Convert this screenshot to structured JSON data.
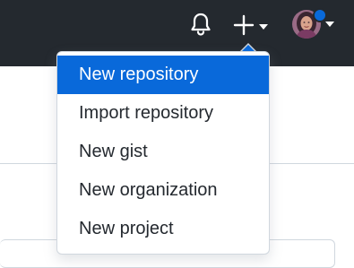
{
  "header": {
    "icons": {
      "notifications": "bell-icon",
      "create": "plus-icon",
      "create_caret": "caret-down-icon",
      "avatar_caret": "caret-down-icon"
    },
    "status_color": "#0969da",
    "background_color": "#24292f"
  },
  "create_menu": {
    "items": [
      {
        "label": "New repository",
        "active": true
      },
      {
        "label": "Import repository",
        "active": false
      },
      {
        "label": "New gist",
        "active": false
      },
      {
        "label": "New organization",
        "active": false
      },
      {
        "label": "New project",
        "active": false
      }
    ],
    "active_color": "#0969da"
  }
}
